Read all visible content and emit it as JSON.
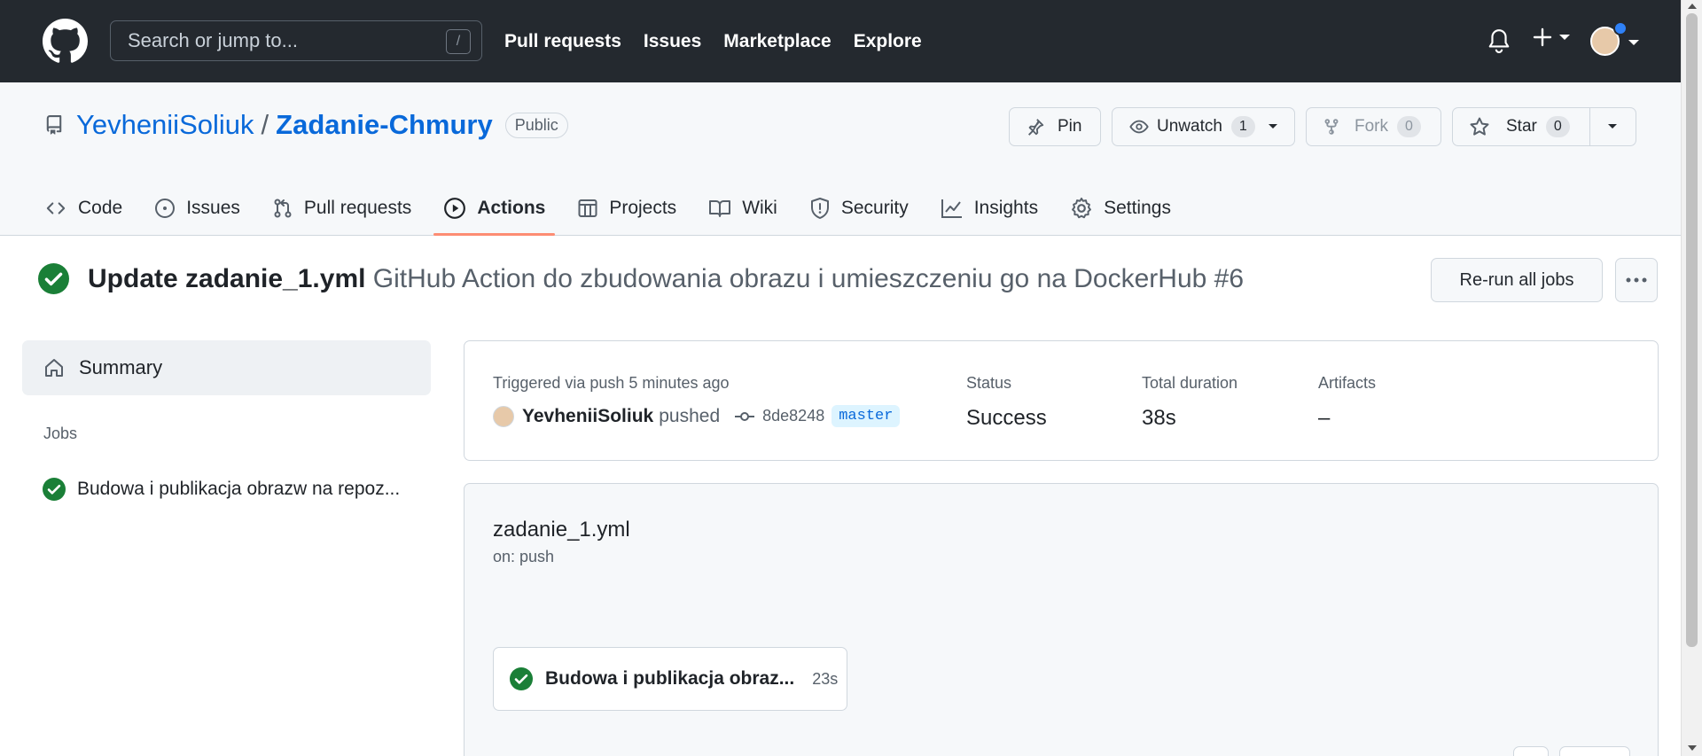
{
  "header": {
    "search_placeholder": "Search or jump to...",
    "search_shortcut": "/",
    "nav": [
      {
        "label": "Pull requests"
      },
      {
        "label": "Issues"
      },
      {
        "label": "Marketplace"
      },
      {
        "label": "Explore"
      }
    ]
  },
  "repo": {
    "owner": "YevheniiSoliuk",
    "separator": "/",
    "name": "Zadanie-Chmury",
    "visibility": "Public",
    "pin_label": "Pin",
    "unwatch_label": "Unwatch",
    "watch_count": "1",
    "fork_label": "Fork",
    "fork_count": "0",
    "star_label": "Star",
    "star_count": "0",
    "tabs": [
      {
        "label": "Code",
        "icon": "code-icon"
      },
      {
        "label": "Issues",
        "icon": "issue-icon"
      },
      {
        "label": "Pull requests",
        "icon": "pull-request-icon"
      },
      {
        "label": "Actions",
        "icon": "play-icon",
        "active": true
      },
      {
        "label": "Projects",
        "icon": "table-icon"
      },
      {
        "label": "Wiki",
        "icon": "book-icon"
      },
      {
        "label": "Security",
        "icon": "shield-icon"
      },
      {
        "label": "Insights",
        "icon": "graph-icon"
      },
      {
        "label": "Settings",
        "icon": "gear-icon"
      }
    ]
  },
  "run": {
    "commit_title": "Update zadanie_1.yml",
    "workflow_title": "GitHub Action do zbudowania obrazu i umieszczeniu go na DockerHub #6",
    "rerun_label": "Re-run all jobs",
    "status_color": "#1a7f37"
  },
  "sidebar": {
    "summary_label": "Summary",
    "jobs_heading": "Jobs",
    "jobs": [
      {
        "label": "Budowa i publikacja obrazw na repoz..."
      }
    ]
  },
  "summary": {
    "triggered": "Triggered via push 5 minutes ago",
    "user": "YevheniiSoliuk",
    "verb": "pushed",
    "commit_sha": "8de8248",
    "branch": "master",
    "status_label": "Status",
    "status_value": "Success",
    "duration_label": "Total duration",
    "duration_value": "38s",
    "artifacts_label": "Artifacts",
    "artifacts_value": "–"
  },
  "workflow": {
    "file": "zadanie_1.yml",
    "trigger": "on: push",
    "job_name": "Budowa i publikacja obraz...",
    "job_duration": "23s"
  }
}
